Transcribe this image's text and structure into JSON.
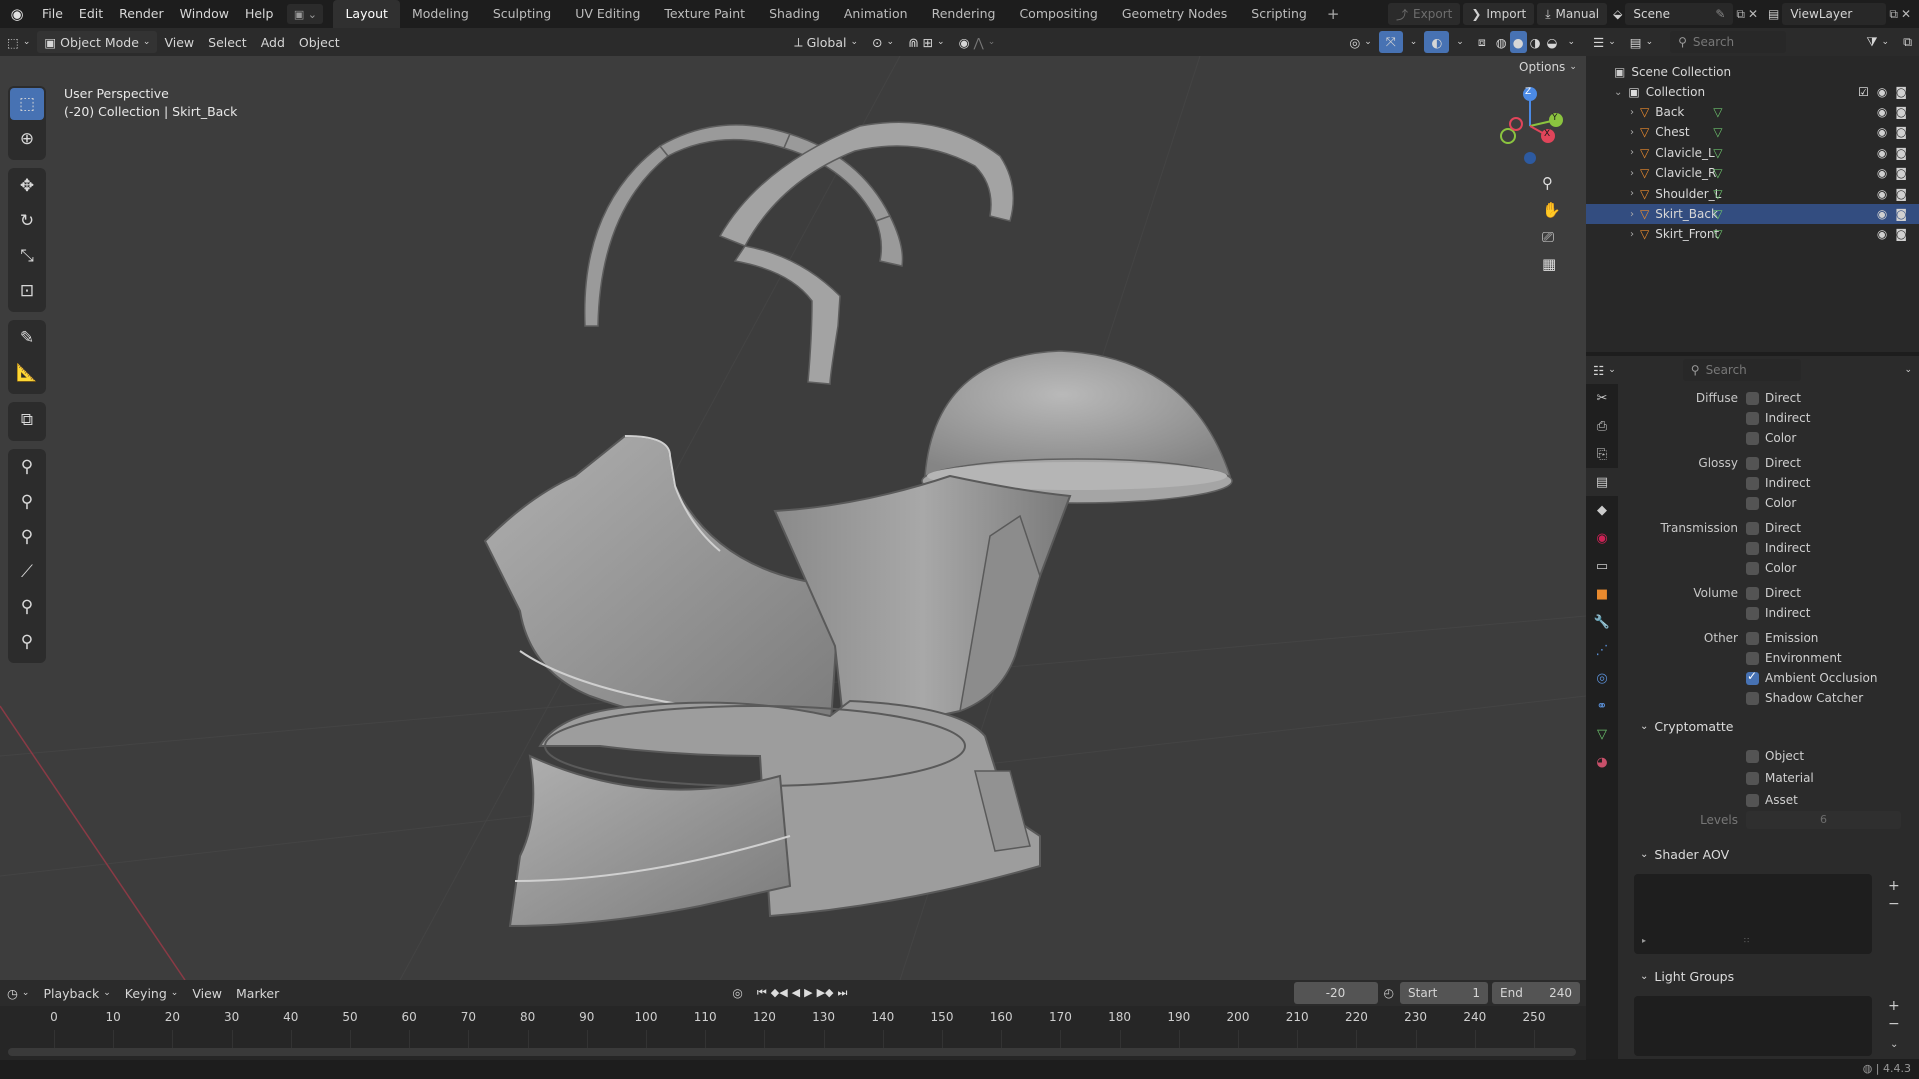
{
  "menu": {
    "items": [
      "File",
      "Edit",
      "Render",
      "Window",
      "Help"
    ],
    "workspaces": [
      "Layout",
      "Modeling",
      "Sculpting",
      "UV Editing",
      "Texture Paint",
      "Shading",
      "Animation",
      "Rendering",
      "Compositing",
      "Geometry Nodes",
      "Scripting"
    ],
    "active_workspace": "Layout",
    "export_label": "Export",
    "import_label": "Import",
    "manual_label": "Manual",
    "scene_name": "Scene",
    "view_layer": "ViewLayer"
  },
  "viewport_header": {
    "mode": "Object Mode",
    "menus": [
      "View",
      "Select",
      "Add",
      "Object"
    ],
    "transform_orientation": "Global",
    "options_label": "Options"
  },
  "viewport": {
    "perspective_label": "User Perspective",
    "context_label": "(-20) Collection | Skirt_Back",
    "gizmo": {
      "z": "Z",
      "y": "Y",
      "x": "X"
    }
  },
  "outliner": {
    "search_placeholder": "Search",
    "scene_collection": "Scene Collection",
    "collection": "Collection",
    "objects": [
      {
        "name": "Back",
        "selected": false
      },
      {
        "name": "Chest",
        "selected": false
      },
      {
        "name": "Clavicle_L",
        "selected": false
      },
      {
        "name": "Clavicle_R",
        "selected": false
      },
      {
        "name": "Shoulder_L",
        "selected": false
      },
      {
        "name": "Skirt_Back",
        "selected": true
      },
      {
        "name": "Skirt_Front",
        "selected": false
      }
    ]
  },
  "properties": {
    "search_placeholder": "Search",
    "passes": {
      "diffuse": {
        "label": "Diffuse",
        "items": [
          "Direct",
          "Indirect",
          "Color"
        ]
      },
      "glossy": {
        "label": "Glossy",
        "items": [
          "Direct",
          "Indirect",
          "Color"
        ]
      },
      "transmission": {
        "label": "Transmission",
        "items": [
          "Direct",
          "Indirect",
          "Color"
        ]
      },
      "volume": {
        "label": "Volume",
        "items": [
          "Direct",
          "Indirect"
        ]
      },
      "other": {
        "label": "Other",
        "items": [
          "Emission",
          "Environment",
          "Ambient Occlusion",
          "Shadow Catcher"
        ],
        "checked": [
          false,
          false,
          true,
          false
        ]
      }
    },
    "cryptomatte": {
      "title": "Cryptomatte",
      "items": [
        "Object",
        "Material",
        "Asset"
      ],
      "levels_label": "Levels",
      "levels_value": "6"
    },
    "shader_aov": {
      "title": "Shader AOV"
    },
    "light_groups": {
      "title": "Light Groups"
    }
  },
  "timeline": {
    "menus": [
      "Playback",
      "Keying",
      "View",
      "Marker"
    ],
    "current_frame": "-20",
    "start_label": "Start",
    "start_value": "1",
    "end_label": "End",
    "end_value": "240",
    "frame_labels": [
      "0",
      "10",
      "20",
      "30",
      "40",
      "50",
      "60",
      "70",
      "80",
      "90",
      "100",
      "110",
      "120",
      "130",
      "140",
      "150",
      "160",
      "170",
      "180",
      "190",
      "200",
      "210",
      "220",
      "230",
      "240",
      "250"
    ]
  },
  "status": {
    "version": "4.4.3"
  },
  "colors": {
    "accent": "#4772b3",
    "selected_row": "#334d80",
    "x_axis": "#e0455a",
    "y_axis": "#8bc43f",
    "z_axis": "#4b8ae5"
  }
}
